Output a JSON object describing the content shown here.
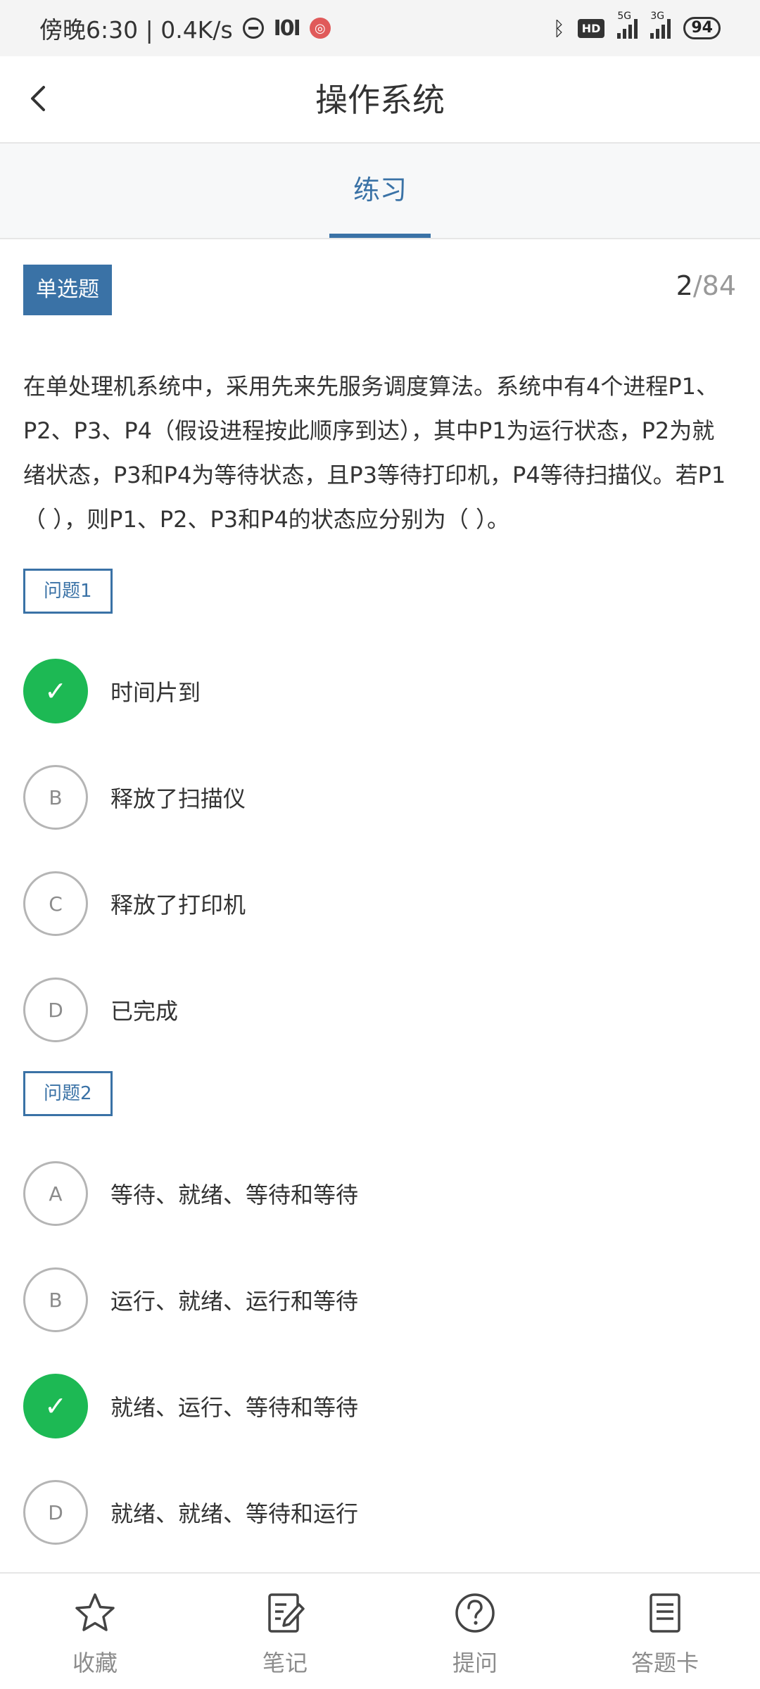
{
  "status_bar": {
    "time_text": "傍晚6:30 | 0.4K/s",
    "network_5g": "5G",
    "network_3g": "3G",
    "hd_label": "HD",
    "battery": "94"
  },
  "header": {
    "title": "操作系统"
  },
  "tabs": [
    {
      "label": "练习",
      "active": true
    }
  ],
  "question": {
    "type_label": "单选题",
    "current": "2",
    "total": "/84",
    "stem": "在单处理机系统中，采用先来先服务调度算法。系统中有4个进程P1、P2、P3、P4（假设进程按此顺序到达），其中P1为运行状态，P2为就绪状态，P3和P4为等待状态，且P3等待打印机，P4等待扫描仪。若P1（ ），则P1、P2、P3和P4的状态应分别为（ ）。",
    "sub_questions": [
      {
        "label": "问题1",
        "options": [
          {
            "letter": "A",
            "text": "时间片到",
            "selected": true,
            "mark": "✓"
          },
          {
            "letter": "B",
            "text": "释放了扫描仪",
            "selected": false
          },
          {
            "letter": "C",
            "text": "释放了打印机",
            "selected": false
          },
          {
            "letter": "D",
            "text": "已完成",
            "selected": false
          }
        ]
      },
      {
        "label": "问题2",
        "options": [
          {
            "letter": "A",
            "text": "等待、就绪、等待和等待",
            "selected": false
          },
          {
            "letter": "B",
            "text": "运行、就绪、运行和等待",
            "selected": false
          },
          {
            "letter": "C",
            "text": "就绪、运行、等待和等待",
            "selected": true,
            "mark": "✓"
          },
          {
            "letter": "D",
            "text": "就绪、就绪、等待和运行",
            "selected": false
          }
        ]
      }
    ]
  },
  "bottom_bar": {
    "items": [
      {
        "label": "收藏",
        "icon": "star-icon"
      },
      {
        "label": "笔记",
        "icon": "note-icon"
      },
      {
        "label": "提问",
        "icon": "question-icon"
      },
      {
        "label": "答题卡",
        "icon": "answer-card-icon"
      }
    ]
  },
  "colors": {
    "accent": "#3a72a6",
    "correct": "#1db954",
    "muted": "#8c8c8c"
  }
}
